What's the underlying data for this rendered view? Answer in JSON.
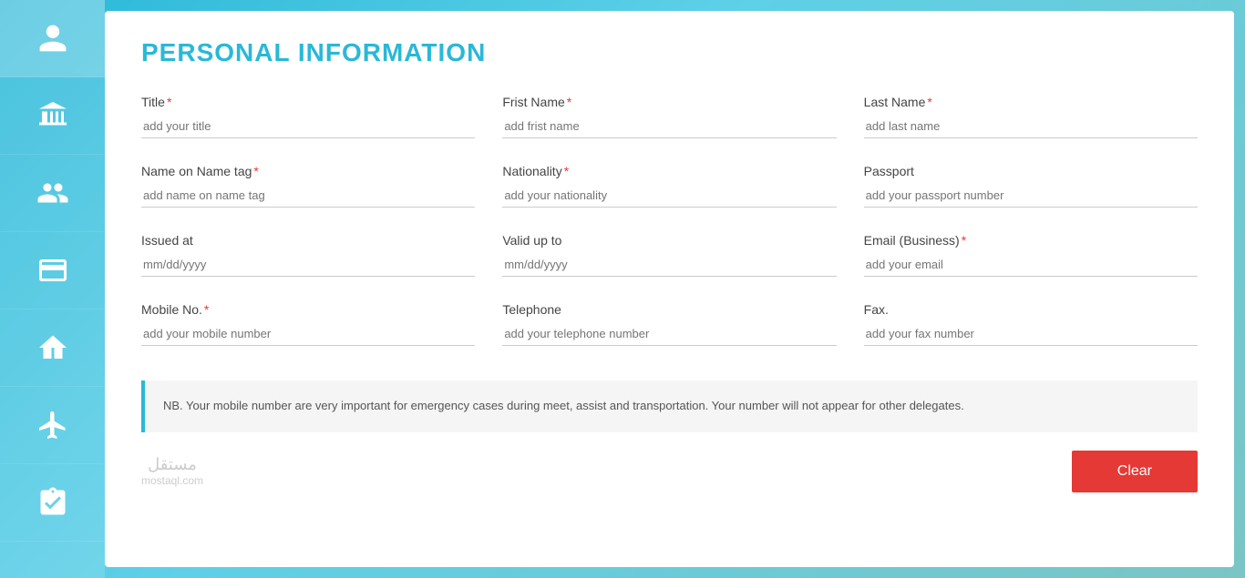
{
  "page": {
    "title": "PERSONAL INFORMATION"
  },
  "sidebar": {
    "items": [
      {
        "id": "person",
        "icon": "person-icon",
        "active": true
      },
      {
        "id": "bank",
        "icon": "bank-icon",
        "active": false
      },
      {
        "id": "group",
        "icon": "group-icon",
        "active": false
      },
      {
        "id": "payment",
        "icon": "payment-icon",
        "active": false
      },
      {
        "id": "worker",
        "icon": "worker-icon",
        "active": false
      },
      {
        "id": "plane",
        "icon": "plane-icon",
        "active": false
      },
      {
        "id": "checklist",
        "icon": "checklist-icon",
        "active": false
      }
    ]
  },
  "form": {
    "fields": {
      "title": {
        "label": "Title",
        "placeholder": "add your title",
        "required": true
      },
      "first_name": {
        "label": "Frist Name",
        "placeholder": "add frist name",
        "required": true
      },
      "last_name": {
        "label": "Last Name",
        "placeholder": "add last name",
        "required": true
      },
      "name_on_tag": {
        "label": "Name on Name tag",
        "placeholder": "add name on name tag",
        "required": true
      },
      "nationality": {
        "label": "Nationality",
        "placeholder": "add your nationality",
        "required": true
      },
      "passport": {
        "label": "Passport",
        "placeholder": "add your passport number",
        "required": false
      },
      "issued_at": {
        "label": "Issued at",
        "placeholder": "mm/dd/yyyy",
        "required": false
      },
      "valid_up_to": {
        "label": "Valid up to",
        "placeholder": "mm/dd/yyyy",
        "required": false
      },
      "email_business": {
        "label": "Email (Business)",
        "placeholder": "add your email",
        "required": true
      },
      "mobile_no": {
        "label": "Mobile No.",
        "placeholder": "add your mobile number",
        "required": true
      },
      "telephone": {
        "label": "Telephone",
        "placeholder": "add your telephone number",
        "required": false
      },
      "fax": {
        "label": "Fax.",
        "placeholder": "add your fax number",
        "required": false
      }
    }
  },
  "notice": {
    "text": "NB. Your mobile number are very important for emergency cases during meet, assist and transportation. Your number will not appear for other delegates."
  },
  "buttons": {
    "clear": "Clear"
  },
  "watermark": {
    "arabic": "مستقل",
    "latin": "mostaql.com"
  },
  "colors": {
    "primary": "#29b8d8",
    "required": "#e53935",
    "clear_btn": "#e53935"
  }
}
